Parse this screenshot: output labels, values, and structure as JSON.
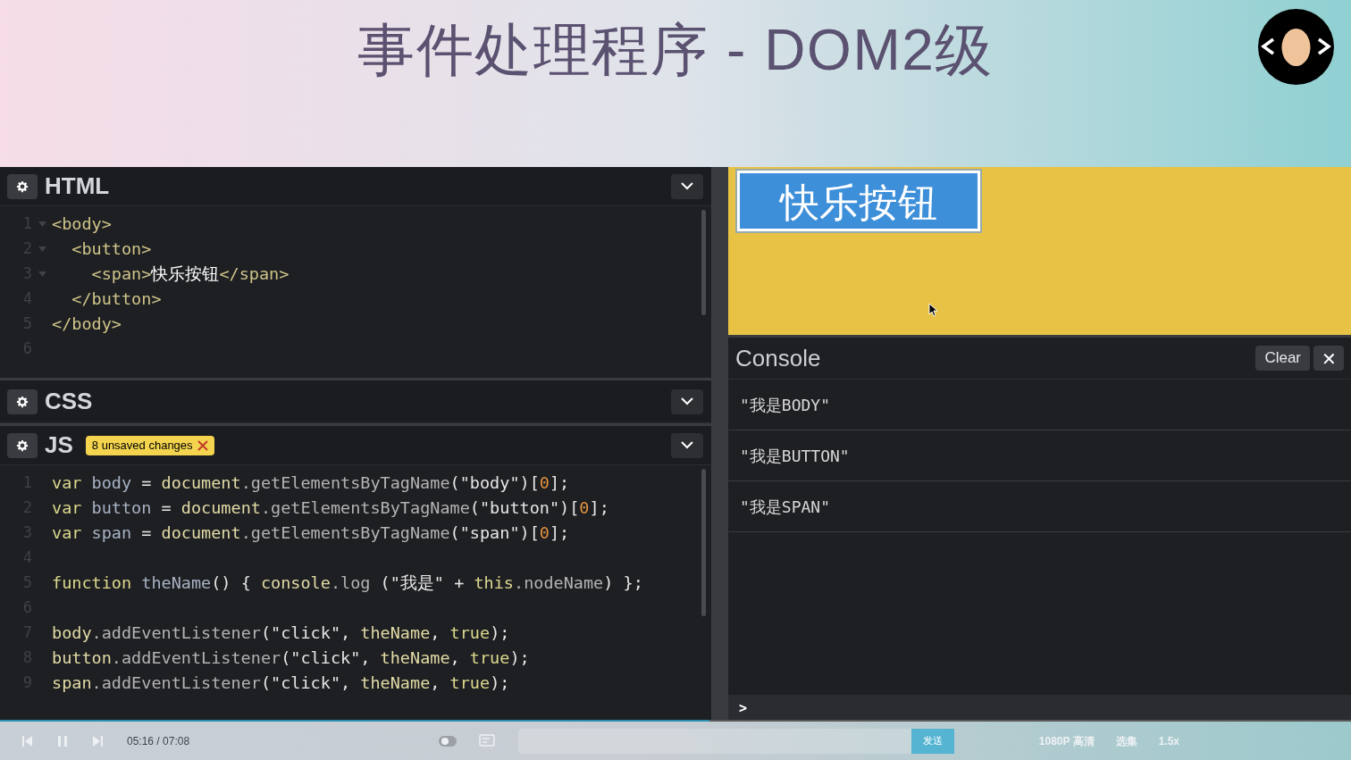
{
  "slide": {
    "title": "事件处理程序 - DOM2级"
  },
  "panels": [
    {
      "kind": "code",
      "title": "HTML",
      "lines": [
        {
          "n": "1",
          "fold": true,
          "tokens": [
            {
              "kind": "tag",
              "text": "<body>"
            }
          ]
        },
        {
          "n": "2",
          "fold": true,
          "tokens": [
            {
              "kind": "tag",
              "text": "  <button>"
            }
          ]
        },
        {
          "n": "3",
          "fold": true,
          "tokens": [
            {
              "kind": "tag",
              "text": "    <span>"
            },
            {
              "kind": "text",
              "text": "快乐按钮"
            },
            {
              "kind": "tag",
              "text": "</span>"
            }
          ]
        },
        {
          "n": "4",
          "fold": false,
          "tokens": [
            {
              "kind": "tag",
              "text": "  </button>"
            }
          ]
        },
        {
          "n": "5",
          "fold": false,
          "tokens": [
            {
              "kind": "tag",
              "text": "</body>"
            }
          ]
        },
        {
          "n": "6",
          "fold": false
        }
      ]
    },
    {
      "kind": "collapsed",
      "title": "CSS"
    },
    {
      "kind": "code",
      "title": "JS",
      "badge": "8 unsaved changes",
      "lines": [
        {
          "n": "1",
          "tokens": [
            {
              "kind": "keyword",
              "text": "var"
            },
            {
              "kind": "variable",
              "text": " body "
            },
            {
              "kind": "punct",
              "text": "= "
            },
            {
              "kind": "global",
              "text": "document"
            },
            {
              "kind": "method",
              "text": ".getElementsByTagName"
            },
            {
              "kind": "punct",
              "text": "("
            },
            {
              "kind": "string",
              "text": "\"body\""
            },
            {
              "kind": "punct",
              "text": ")["
            },
            {
              "kind": "number",
              "text": "0"
            },
            {
              "kind": "punct",
              "text": "];"
            }
          ]
        },
        {
          "n": "2",
          "tokens": [
            {
              "kind": "keyword",
              "text": "var"
            },
            {
              "kind": "variable",
              "text": " button "
            },
            {
              "kind": "punct",
              "text": "= "
            },
            {
              "kind": "global",
              "text": "document"
            },
            {
              "kind": "method",
              "text": ".getElementsByTagName"
            },
            {
              "kind": "punct",
              "text": "("
            },
            {
              "kind": "string",
              "text": "\"button\""
            },
            {
              "kind": "punct",
              "text": ")["
            },
            {
              "kind": "number",
              "text": "0"
            },
            {
              "kind": "punct",
              "text": "];"
            }
          ]
        },
        {
          "n": "3",
          "tokens": [
            {
              "kind": "keyword",
              "text": "var"
            },
            {
              "kind": "variable",
              "text": " span "
            },
            {
              "kind": "punct",
              "text": "= "
            },
            {
              "kind": "global",
              "text": "document"
            },
            {
              "kind": "method",
              "text": ".getElementsByTagName"
            },
            {
              "kind": "punct",
              "text": "("
            },
            {
              "kind": "string",
              "text": "\"span\""
            },
            {
              "kind": "punct",
              "text": ")["
            },
            {
              "kind": "number",
              "text": "0"
            },
            {
              "kind": "punct",
              "text": "];"
            }
          ]
        },
        {
          "n": "4"
        },
        {
          "n": "5",
          "tokens": [
            {
              "kind": "keyword",
              "text": "function"
            },
            {
              "kind": "variable",
              "text": " theName"
            },
            {
              "kind": "punct",
              "text": "() { "
            },
            {
              "kind": "global",
              "text": "console"
            },
            {
              "kind": "method",
              "text": ".log"
            },
            {
              "kind": "punct",
              "text": " ("
            },
            {
              "kind": "string",
              "text": "\"我是\""
            },
            {
              "kind": "punct",
              "text": " + "
            },
            {
              "kind": "keyword",
              "text": "this"
            },
            {
              "kind": "method",
              "text": ".nodeName"
            },
            {
              "kind": "punct",
              "text": ") };"
            }
          ]
        },
        {
          "n": "6"
        },
        {
          "n": "7",
          "tokens": [
            {
              "kind": "global",
              "text": "body"
            },
            {
              "kind": "method",
              "text": ".addEventListener"
            },
            {
              "kind": "punct",
              "text": "("
            },
            {
              "kind": "string",
              "text": "\"click\""
            },
            {
              "kind": "punct",
              "text": ", "
            },
            {
              "kind": "global",
              "text": "theName"
            },
            {
              "kind": "punct",
              "text": ", "
            },
            {
              "kind": "keyword",
              "text": "true"
            },
            {
              "kind": "punct",
              "text": ");"
            }
          ]
        },
        {
          "n": "8",
          "tokens": [
            {
              "kind": "global",
              "text": "button"
            },
            {
              "kind": "method",
              "text": ".addEventListener"
            },
            {
              "kind": "punct",
              "text": "("
            },
            {
              "kind": "string",
              "text": "\"click\""
            },
            {
              "kind": "punct",
              "text": ", "
            },
            {
              "kind": "global",
              "text": "theName"
            },
            {
              "kind": "punct",
              "text": ", "
            },
            {
              "kind": "keyword",
              "text": "true"
            },
            {
              "kind": "punct",
              "text": ");"
            }
          ]
        },
        {
          "n": "9",
          "tokens": [
            {
              "kind": "global",
              "text": "span"
            },
            {
              "kind": "method",
              "text": ".addEventListener"
            },
            {
              "kind": "punct",
              "text": "("
            },
            {
              "kind": "string",
              "text": "\"click\""
            },
            {
              "kind": "punct",
              "text": ", "
            },
            {
              "kind": "global",
              "text": "theName"
            },
            {
              "kind": "punct",
              "text": ", "
            },
            {
              "kind": "keyword",
              "text": "true"
            },
            {
              "kind": "punct",
              "text": ");"
            }
          ]
        }
      ]
    }
  ],
  "preview": {
    "button": "快乐按钮"
  },
  "console": {
    "title": "Console",
    "clear": "Clear",
    "close": "✕",
    "entries": [
      "\"我是BODY\"",
      "\"我是BUTTON\"",
      "\"我是SPAN\""
    ],
    "prompt": ">"
  },
  "player": {
    "level": 0.525,
    "time": "05:16 / 07:08",
    "send": "发送",
    "quality": "1080P 高清",
    "episodes": "选集",
    "speed": "1.5x"
  }
}
